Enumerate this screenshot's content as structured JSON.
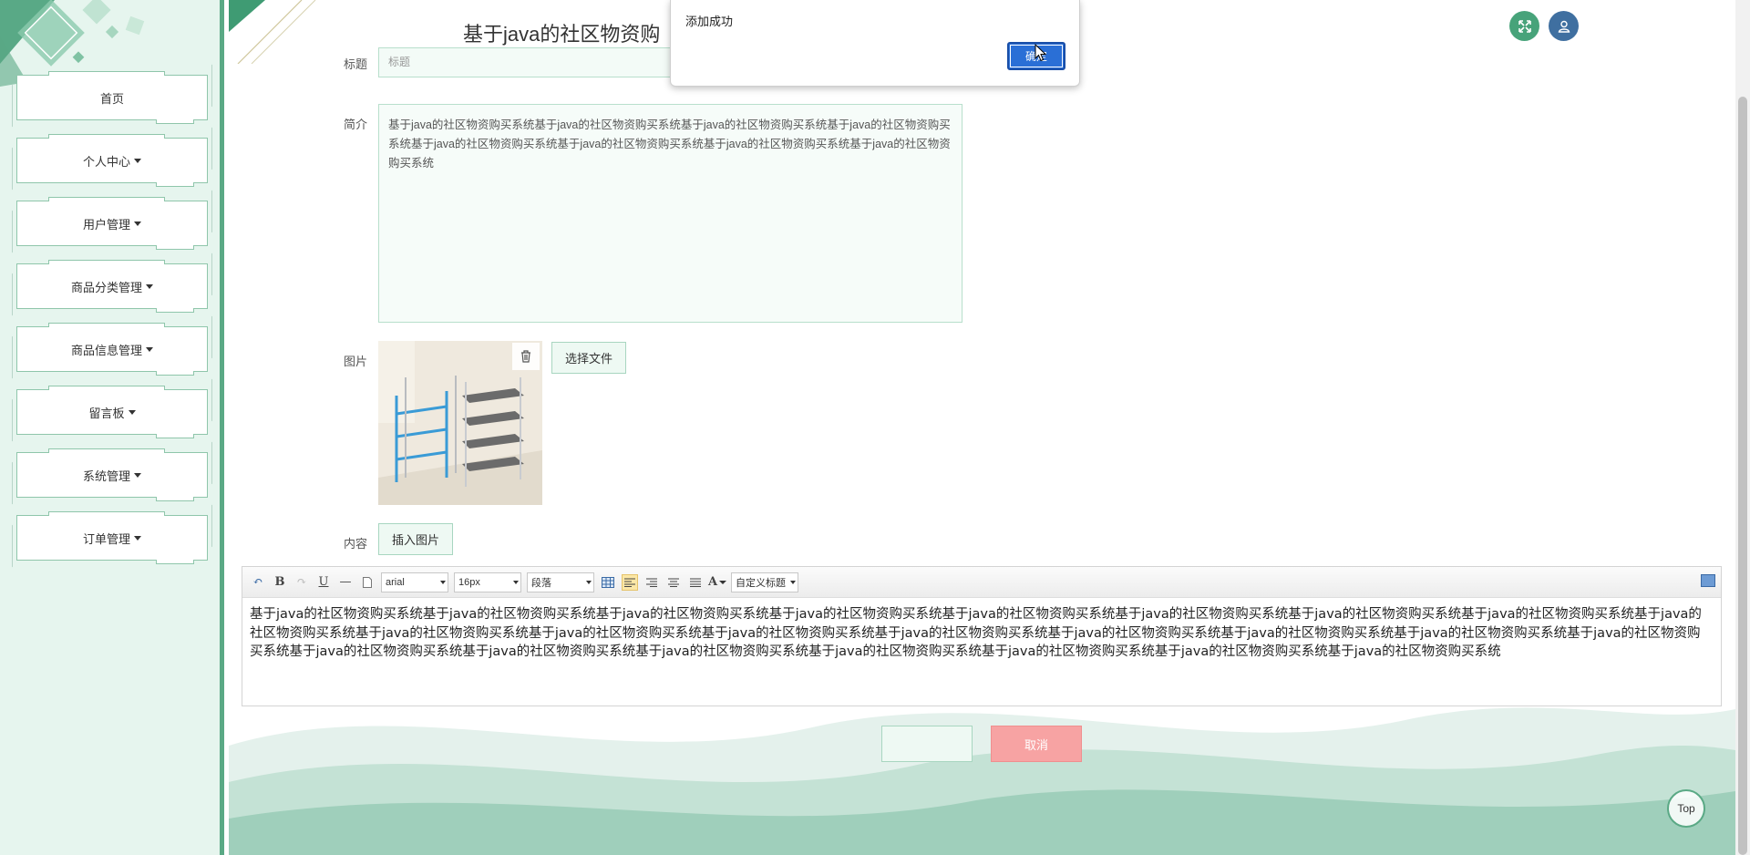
{
  "sidebar": {
    "items": [
      {
        "label": "首页",
        "has_caret": false
      },
      {
        "label": "个人中心",
        "has_caret": true
      },
      {
        "label": "用户管理",
        "has_caret": true
      },
      {
        "label": "商品分类管理",
        "has_caret": true
      },
      {
        "label": "商品信息管理",
        "has_caret": true
      },
      {
        "label": "留言板",
        "has_caret": true
      },
      {
        "label": "系统管理",
        "has_caret": true
      },
      {
        "label": "订单管理",
        "has_caret": true
      }
    ]
  },
  "header": {
    "title": "基于java的社区物资购",
    "icons": [
      "fullscreen-icon",
      "user-icon"
    ]
  },
  "form": {
    "title_label": "标题",
    "title_value": "标题",
    "intro_label": "简介",
    "intro_value": "基于java的社区物资购买系统基于java的社区物资购买系统基于java的社区物资购买系统基于java的社区物资购买系统基于java的社区物资购买系统基于java的社区物资购买系统基于java的社区物资购买系统基于java的社区物资购买系统",
    "image_label": "图片",
    "choose_file": "选择文件",
    "content_label": "内容",
    "insert_image": "插入图片"
  },
  "editor": {
    "font_family": "arial",
    "font_size": "16px",
    "paragraph": "段落",
    "custom_heading": "自定义标题",
    "body": "基于java的社区物资购买系统基于java的社区物资购买系统基于java的社区物资购买系统基于java的社区物资购买系统基于java的社区物资购买系统基于java的社区物资购买系统基于java的社区物资购买系统基于java的社区物资购买系统基于java的社区物资购买系统基于java的社区物资购买系统基于java的社区物资购买系统基于java的社区物资购买系统基于java的社区物资购买系统基于java的社区物资购买系统基于java的社区物资购买系统基于java的社区物资购买系统基于java的社区物资购买系统基于java的社区物资购买系统基于java的社区物资购买系统基于java的社区物资购买系统基于java的社区物资购买系统基于java的社区物资购买系统基于java的社区物资购买系统基于java的社区物资购买系统"
  },
  "actions": {
    "submit": "",
    "cancel": "取消",
    "top": "Top"
  },
  "alert": {
    "message": "添加成功",
    "ok": "确定"
  },
  "colors": {
    "accent": "#47a37a",
    "sidebar_bg": "#e6f5ee",
    "cancel": "#f7a3a3",
    "dialog_button": "#2a6fd6"
  }
}
